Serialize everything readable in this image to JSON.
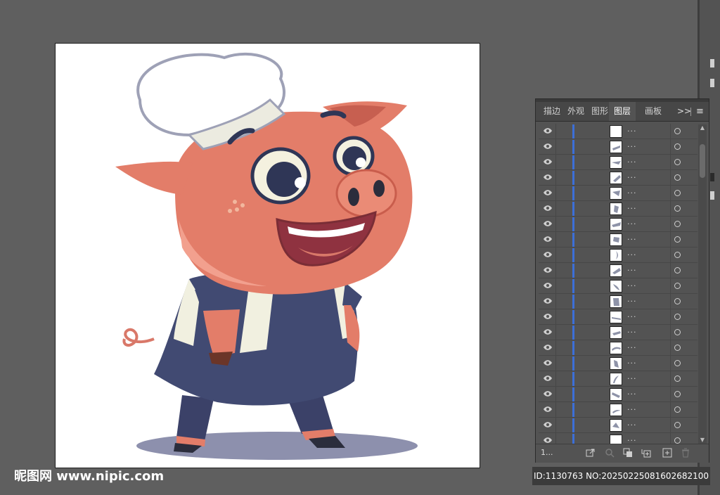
{
  "panel": {
    "tabs": [
      {
        "label": "描边"
      },
      {
        "label": "外观"
      },
      {
        "label": "图形"
      },
      {
        "label": "图层"
      },
      {
        "label": "画板"
      }
    ],
    "more_label": ">>",
    "menu_label": "≡",
    "active_tab": "图层",
    "layer_count": "1...",
    "row_dots": "...",
    "layer_color": "#3c6fd8"
  },
  "watermark": {
    "site": "昵图网 www.nipic.com",
    "id_line": "ID:1130763 NO:20250225081602682100"
  },
  "icons": [
    "eye-icon",
    "target-icon",
    "export-icon",
    "search-icon",
    "clip-icon",
    "new-sublayer-icon",
    "new-layer-icon",
    "trash-icon"
  ]
}
